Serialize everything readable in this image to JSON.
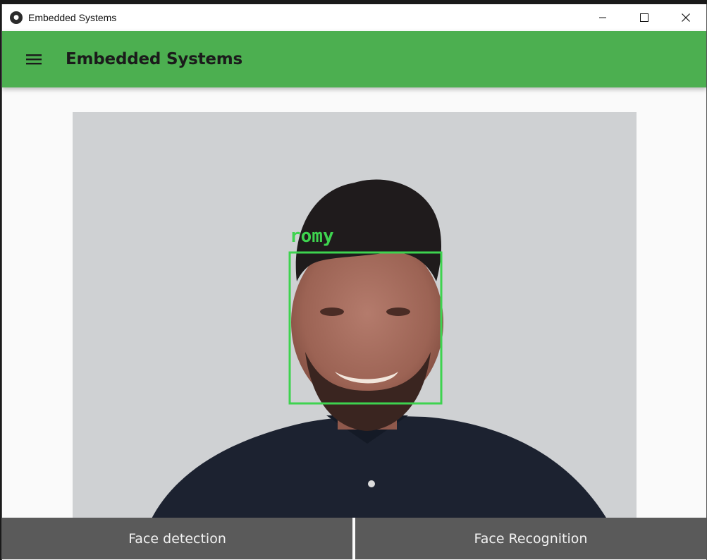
{
  "window": {
    "title": "Embedded Systems"
  },
  "app_bar": {
    "title": "Embedded Systems",
    "menu_icon": "hamburger-menu-icon"
  },
  "camera": {
    "detected_label": "romy",
    "box_color": "#3ed34f"
  },
  "buttons": {
    "face_detection": "Face detection",
    "face_recognition": "Face Recognition"
  },
  "colors": {
    "app_bar": "#4caf50",
    "button_bg": "#5a5a5a",
    "button_text": "#f2f2f2"
  }
}
